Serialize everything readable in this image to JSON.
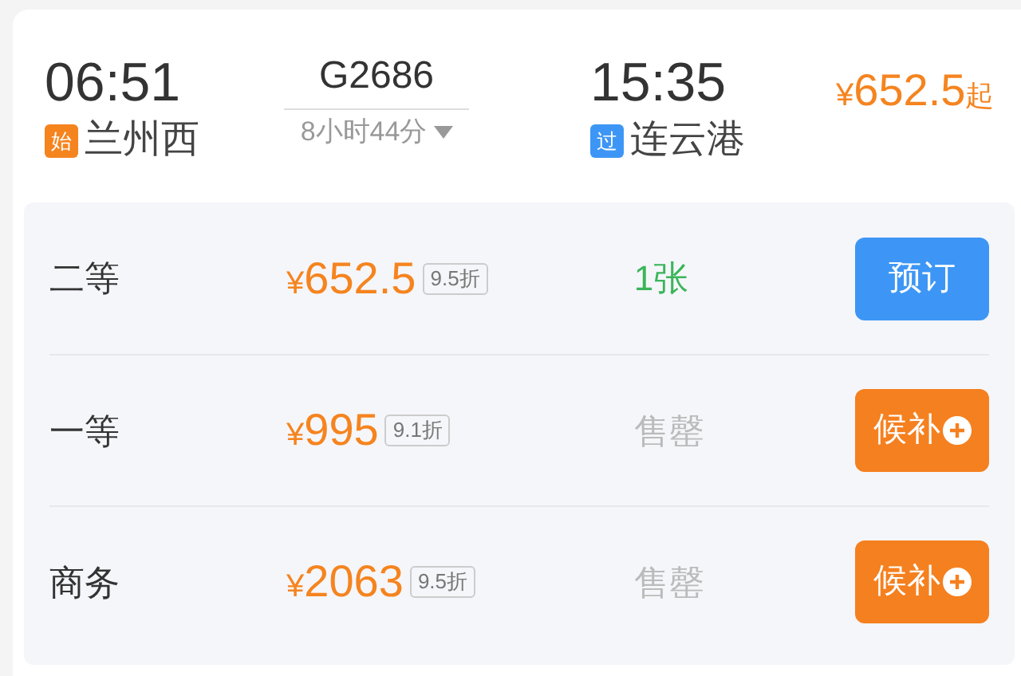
{
  "departure": {
    "time": "06:51",
    "badge": {
      "text": "始",
      "color": "#f5841f"
    },
    "station": "兰州西"
  },
  "train": {
    "number": "G2686",
    "duration": "8小时44分",
    "expanded": false
  },
  "arrival": {
    "time": "15:35",
    "badge": {
      "text": "过",
      "color": "#3d96f5"
    },
    "station": "连云港"
  },
  "lowest_price": {
    "currency": "¥",
    "amount": "652.5",
    "suffix": "起"
  },
  "seats": [
    {
      "class": "二等",
      "currency": "¥",
      "price": "652.5",
      "discount": "9.5折",
      "availability": "1张",
      "kind": "available",
      "action": "预订"
    },
    {
      "class": "一等",
      "currency": "¥",
      "price": "995",
      "discount": "9.1折",
      "availability": "售罄",
      "kind": "soldout",
      "action": "候补"
    },
    {
      "class": "商务",
      "currency": "¥",
      "price": "2063",
      "discount": "9.5折",
      "availability": "售罄",
      "kind": "soldout",
      "action": "候补"
    }
  ]
}
